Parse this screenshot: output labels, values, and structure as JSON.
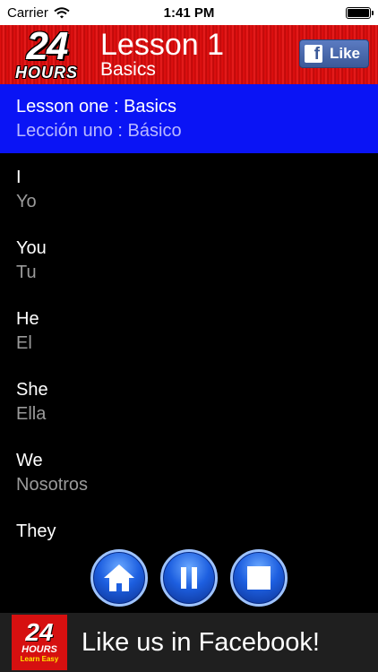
{
  "status_bar": {
    "carrier": "Carrier",
    "time": "1:41 PM"
  },
  "header": {
    "logo_number": "24",
    "logo_word": "HOURS",
    "title": "Lesson 1",
    "subtitle": "Basics",
    "like_label": "Like",
    "fb_glyph": "f",
    "accent_color": "#e41010"
  },
  "lesson": {
    "english": "Lesson one : Basics",
    "spanish": "Lección uno : Básico",
    "banner_color": "#0a14f5"
  },
  "words": [
    {
      "english": "I",
      "spanish": "Yo"
    },
    {
      "english": "You",
      "spanish": "Tu"
    },
    {
      "english": "He",
      "spanish": "El"
    },
    {
      "english": "She",
      "spanish": "Ella"
    },
    {
      "english": "We",
      "spanish": "Nosotros"
    },
    {
      "english": "They",
      "spanish": ""
    }
  ],
  "controls": {
    "icons": [
      "home-icon",
      "pause-icon",
      "stop-icon"
    ]
  },
  "footer": {
    "logo_number": "24",
    "logo_word": "HOURS",
    "logo_tag": "Learn Easy",
    "text": "Like us in Facebook!"
  }
}
